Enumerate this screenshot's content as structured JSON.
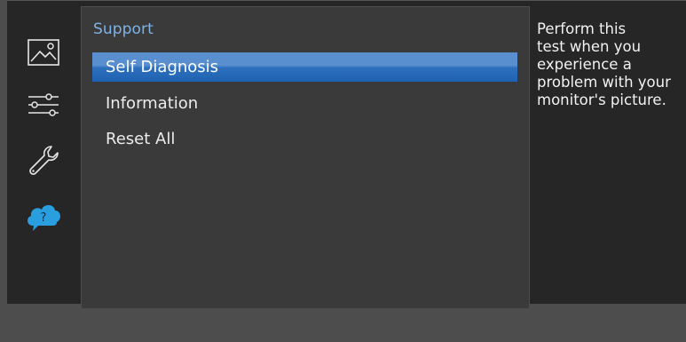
{
  "sidebar": {
    "items": [
      {
        "icon": "picture-icon"
      },
      {
        "icon": "sliders-icon"
      },
      {
        "icon": "wrench-icon"
      },
      {
        "icon": "support-cloud-icon",
        "badge": "?",
        "color": "#2a9fe0"
      }
    ]
  },
  "panel": {
    "title": "Support",
    "items": [
      {
        "label": "Self Diagnosis",
        "selected": true
      },
      {
        "label": "Information",
        "selected": false
      },
      {
        "label": "Reset All",
        "selected": false
      }
    ]
  },
  "help": {
    "text": "Perform this\ntest when you\nexperience a\nproblem with your\nmonitor's picture."
  },
  "colors": {
    "accent": "#2a9fe0",
    "title": "#7fb3e6",
    "selection": "#2e70bd"
  }
}
